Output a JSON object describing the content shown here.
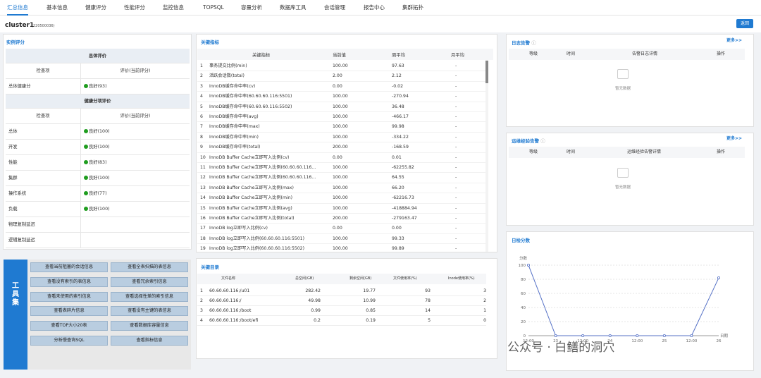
{
  "nav": {
    "tabs": [
      {
        "label": "汇总信息",
        "active": true
      },
      {
        "label": "基本信息"
      },
      {
        "label": "健康评分"
      },
      {
        "label": "性能评分"
      },
      {
        "label": "监控信息"
      },
      {
        "label": "TOPSQL"
      },
      {
        "label": "容量分析"
      },
      {
        "label": "数据库工具"
      },
      {
        "label": "会话管理"
      },
      {
        "label": "报告中心"
      },
      {
        "label": "集群拓扑"
      }
    ]
  },
  "cluster": {
    "name": "cluster1",
    "id": "(220500036)",
    "back_label": "返回"
  },
  "score": {
    "title": "实例评分",
    "overall_header": "总体评价",
    "col_item": "检查项",
    "col_eval": "评价(当前评分)",
    "overall_row": {
      "item": "总体健康分",
      "eval": "良好(93)",
      "dot": true
    },
    "detail_header": "健康分项评价",
    "rows": [
      {
        "item": "总体",
        "eval": "良好(100)",
        "dot": true
      },
      {
        "item": "开发",
        "eval": "良好(100)",
        "dot": true
      },
      {
        "item": "性能",
        "eval": "良好(83)",
        "dot": true
      },
      {
        "item": "集群",
        "eval": "良好(100)",
        "dot": true
      },
      {
        "item": "操作系统",
        "eval": "良好(77)",
        "dot": true
      },
      {
        "item": "负载",
        "eval": "良好(100)",
        "dot": true
      },
      {
        "item": "物理复制延迟",
        "eval": "",
        "dot": false
      },
      {
        "item": "逻辑复制延迟",
        "eval": "",
        "dot": false
      }
    ]
  },
  "tools": {
    "side_label": [
      "工",
      "具",
      "集"
    ],
    "buttons": [
      "查看当前阻塞的会话信息",
      "查看全表扫描的表信息",
      "查看没有索引的表信息",
      "查看冗余索引信息",
      "查看未使用的索引信息",
      "查看选择性差的索引信息",
      "查看表碎片信息",
      "查看没有主键的表信息",
      "查看TOP大小20表",
      "查看数据库容量信息",
      "分析慢查询SQL",
      "查看指标信息"
    ]
  },
  "metrics": {
    "title": "关键指标",
    "headers": [
      "关键指标",
      "当前值",
      "周平均",
      "月平均"
    ],
    "rows": [
      [
        "1",
        "事务提交比例(min)",
        "100.00",
        "97.63",
        "-"
      ],
      [
        "2",
        "活跃会话数(total)",
        "2.00",
        "2.12",
        "-"
      ],
      [
        "3",
        "InnoDB缓存命中率(cv)",
        "0.00",
        "-0.02",
        "-"
      ],
      [
        "4",
        "InnoDB缓存命中率(60.60.60.116:5501)",
        "100.00",
        "-270.94",
        "-"
      ],
      [
        "5",
        "InnoDB缓存命中率(60.60.60.116:5502)",
        "100.00",
        "36.48",
        "-"
      ],
      [
        "6",
        "InnoDB缓存命中率(avg)",
        "100.00",
        "-466.17",
        "-"
      ],
      [
        "7",
        "InnoDB缓存命中率(max)",
        "100.00",
        "99.98",
        "-"
      ],
      [
        "8",
        "InnoDB缓存命中率(min)",
        "100.00",
        "-334.22",
        "-"
      ],
      [
        "9",
        "InnoDB缓存命中率(total)",
        "200.00",
        "-168.59",
        "-"
      ],
      [
        "10",
        "InnoDB Buffer Cache立即写入比例(cv)",
        "0.00",
        "0.01",
        "-"
      ],
      [
        "11",
        "InnoDB Buffer Cache立即写入比例(60.60.60.116...",
        "100.00",
        "-62255.82",
        "-"
      ],
      [
        "12",
        "InnoDB Buffer Cache立即写入比例(60.60.60.116...",
        "100.00",
        "64.55",
        "-"
      ],
      [
        "13",
        "InnoDB Buffer Cache立即写入比例(max)",
        "100.00",
        "66.20",
        "-"
      ],
      [
        "14",
        "InnoDB Buffer Cache立即写入比例(min)",
        "100.00",
        "-62216.73",
        "-"
      ],
      [
        "15",
        "InnoDB Buffer Cache立即写入比例(avg)",
        "100.00",
        "-418884.94",
        "-"
      ],
      [
        "16",
        "InnoDB Buffer Cache立即写入比例(total)",
        "200.00",
        "-279163.47",
        "-"
      ],
      [
        "17",
        "InnoDB log立即写入比例(cv)",
        "0.00",
        "0.00",
        "-"
      ],
      [
        "18",
        "InnoDB log立即写入比例(60.60.60.116:5501)",
        "100.00",
        "99.33",
        "-"
      ],
      [
        "19",
        "InnoDB log立即写入比例(60.60.60.116:5502)",
        "100.00",
        "99.89",
        "-"
      ]
    ]
  },
  "dirs": {
    "title": "关键目录",
    "headers": [
      "文件名称",
      "总空间(GB)",
      "剩余空间(GB)",
      "文件使用率(%)",
      "Inode使用率(%)"
    ],
    "rows": [
      [
        "1",
        "60.60.60.116:/u01",
        "282.42",
        "19.77",
        "93",
        "3"
      ],
      [
        "2",
        "60.60.60.116:/",
        "49.98",
        "10.99",
        "78",
        "2"
      ],
      [
        "3",
        "60.60.60.116:/boot",
        "0.99",
        "0.85",
        "14",
        "1"
      ],
      [
        "4",
        "60.60.60.116:/boot/efi",
        "0.2",
        "0.19",
        "5",
        "0"
      ]
    ]
  },
  "alerts": {
    "title": "日志告警",
    "more": "更多>>",
    "headers": [
      "等级",
      "时间",
      "告警日志详情",
      "操作"
    ],
    "empty": "暂无数据"
  },
  "ops": {
    "title": "运维经验告警",
    "more": "更多>>",
    "headers": [
      "等级",
      "时间",
      "运维经验告警详情",
      "操作"
    ],
    "empty": "暂无数据"
  },
  "daily": {
    "title": "日检分数"
  },
  "chart_data": {
    "type": "line",
    "ylabel": "分数",
    "xlabel": "日期",
    "ylim": [
      0,
      100
    ],
    "yticks": [
      0,
      20,
      40,
      60,
      80,
      100
    ],
    "x": [
      "12:00",
      "23",
      "12:00",
      "24",
      "12:00",
      "25",
      "12:00",
      "26"
    ],
    "series": [
      {
        "values": [
          100,
          0,
          0,
          0,
          0,
          0,
          0,
          82
        ]
      }
    ],
    "color": "#5470c6"
  },
  "watermark": "公众号 · 白鳝的洞穴"
}
